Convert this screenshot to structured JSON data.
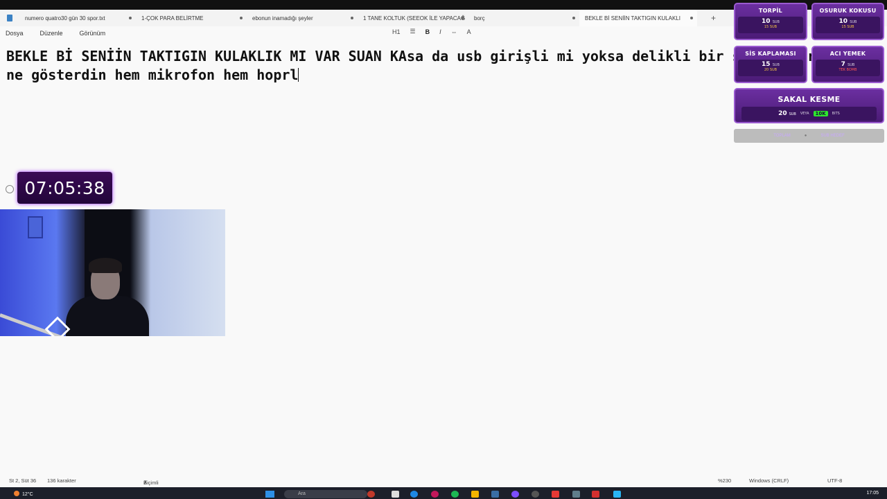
{
  "tabs": [
    {
      "label": "numero quatro30 gün 30 spor.txt",
      "active": false
    },
    {
      "label": "1-ÇOK PARA BELİRTME",
      "active": false
    },
    {
      "label": "ebonun inamadığı şeyler",
      "active": false
    },
    {
      "label": "1 TANE KOLTUK (SEEOK İLE YAPACAĞ",
      "active": false
    },
    {
      "label": "borç",
      "active": false
    },
    {
      "label": "BEKLE Bİ SENİİN TAKTIGIN KULAKLI",
      "active": true
    }
  ],
  "tab_add": "+",
  "menu": {
    "file": "Dosya",
    "edit": "Düzenle",
    "view": "Görünüm"
  },
  "toolbar": {
    "heading": "H1",
    "list": "☰",
    "bold": "B",
    "italic": "I",
    "link": "⇔",
    "format": "A"
  },
  "editor": {
    "line1": "BEKLE Bİ SENİİN TAKTIGIN KULAKLIK MI VAR SUAN KAsa da usb girişli mi yoksa delikli bir şey mi giriş",
    "line2": "ne gösterdin hem mikrofon hem hoprl"
  },
  "timer": {
    "value": "07:05:38"
  },
  "overlay": {
    "buttons": [
      {
        "title": "TORPİL",
        "sub": "10",
        "sub_unit": "SUB",
        "bits": "15 SUB"
      },
      {
        "title": "OSURUK KOKUSU",
        "sub": "10",
        "sub_unit": "SUB",
        "bits": "15 SUB"
      },
      {
        "title": "SİS KAPLAMASI",
        "sub": "15",
        "sub_unit": "SUB",
        "bits": "20 SUB"
      },
      {
        "title": "ACI YEMEK",
        "sub": "7",
        "sub_unit": "SUB",
        "bits": "TEK BOMB"
      }
    ],
    "big": {
      "title": "SAKAL KESME",
      "sub": "20",
      "sub_unit": "SUB",
      "or": "VEYA",
      "bits": "10K",
      "bits_unit": "BITS"
    },
    "strip": {
      "left": "TOPLAM",
      "right": "SUB HEDEF"
    }
  },
  "status": {
    "position": "St 2, Süt 36",
    "chars": "136 karakter",
    "format": "Biçimli",
    "zoom": "%230",
    "eol": "Windows (CRLF)",
    "encoding": "UTF-8"
  },
  "taskbar": {
    "temp": "12°C",
    "search": "Ara",
    "time": "17:05"
  }
}
